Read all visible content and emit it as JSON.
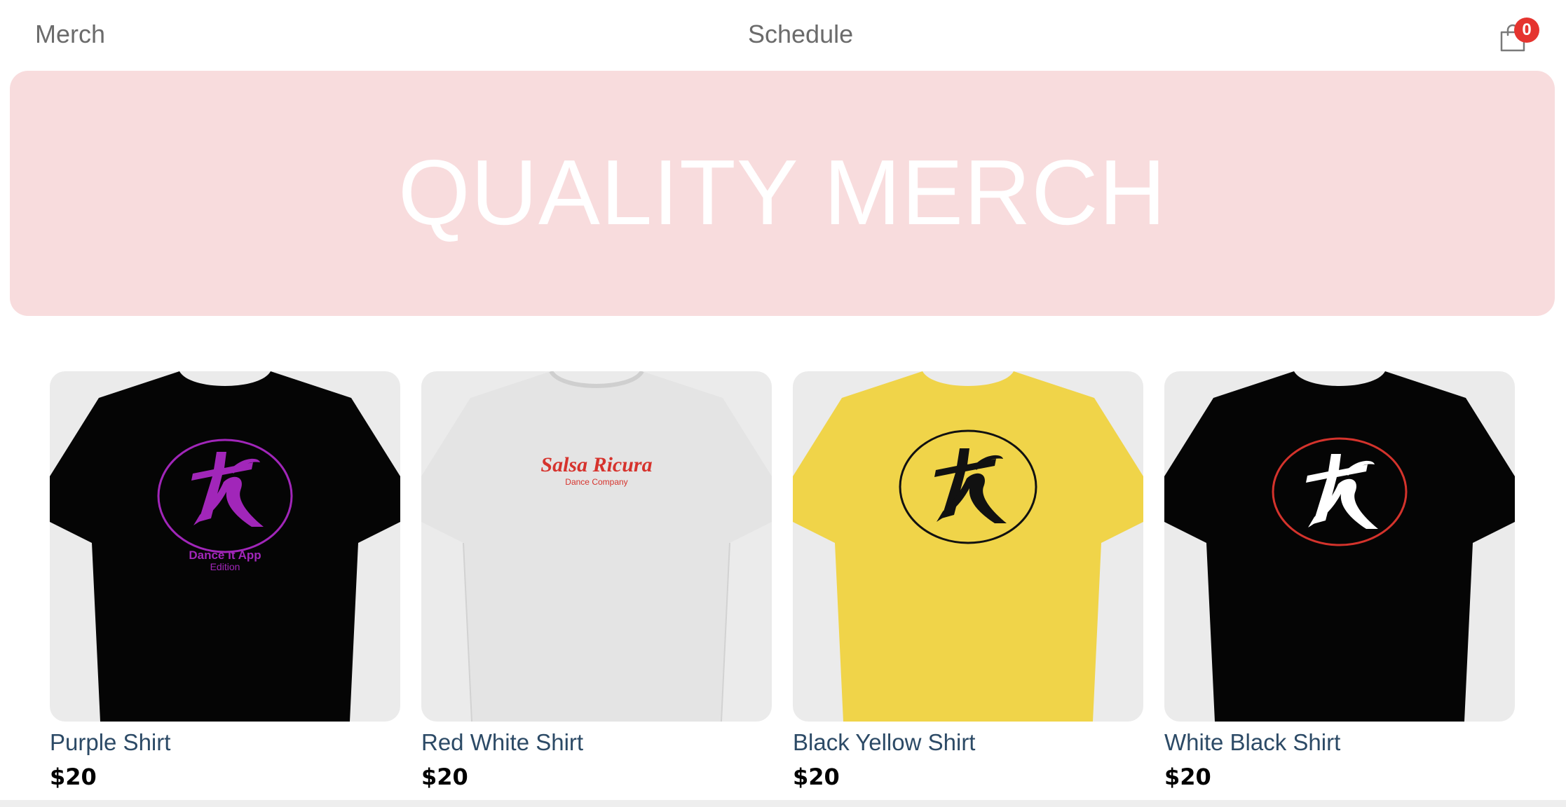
{
  "nav": {
    "merch_label": "Merch",
    "schedule_label": "Schedule",
    "cart_count": "0"
  },
  "hero": {
    "title": "QUALITY MERCH"
  },
  "products": [
    {
      "name": "Purple Shirt",
      "price": "$20",
      "shirt_color": "#050505",
      "graphic": "purple-logo-icon",
      "graphic_color": "#a126b9",
      "print_line1": "Dance It App",
      "print_line2": "Edition"
    },
    {
      "name": "Red White Shirt",
      "price": "$20",
      "shirt_color": "#e4e4e4",
      "graphic": "salsa-ricura-text",
      "graphic_color": "#d6332d",
      "print_line1": "Salsa Ricura",
      "print_line2": "Dance Company"
    },
    {
      "name": "Black Yellow Shirt",
      "price": "$20",
      "shirt_color": "#f0d449",
      "graphic": "black-logo-icon",
      "graphic_color": "#111111"
    },
    {
      "name": "White Black Shirt",
      "price": "$20",
      "shirt_color": "#050505",
      "graphic": "white-logo-icon",
      "graphic_color": "#ffffff",
      "ring_color": "#d4332c"
    }
  ],
  "colors": {
    "hero_bg": "#f8dcdd",
    "badge": "#e5342f",
    "product_name": "#2c4a66",
    "nav_text": "#6b6b6b"
  }
}
